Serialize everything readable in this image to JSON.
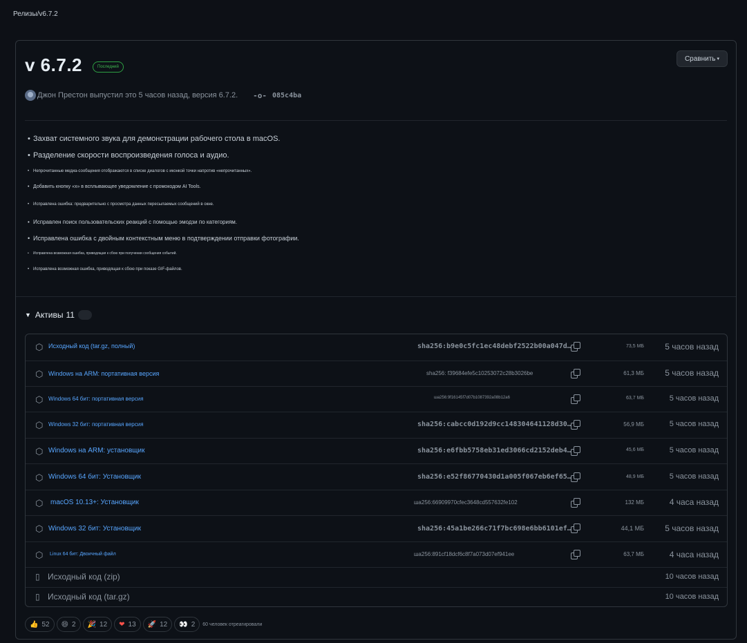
{
  "breadcrumb": "Релизы/v6.7.2",
  "release": {
    "title": "v 6.7.2",
    "badge": "Последний",
    "compare_label": "Сравнить",
    "compare_caret": "▾",
    "byline": "Джон Престон выпустил это 5 часов назад, версия 6.7.2.",
    "commit": "085c4ba"
  },
  "notes": [
    "Захват системного звука для демонстрации рабочего стола в macOS.",
    "Разделение скорости воспроизведения голоса и аудио.",
    "Непрочитанные медиа-сообщения отображаются в списке диалогов с иконкой точки напротив «непрочитанных».",
    "Добавить кнопку «х» в всплывающее уведомление с промокодом AI Tools.",
    "Исправлена ошибка: предварительно с просмотра данных пересылаемых сообщений в окне.",
    "Исправлен поиск пользовательских реакций с помощью эмодзи по категориям.",
    "Исправлена ошибка с двойным контекстным меню в подтверждении отправки фотографии.",
    "Исправлена возможная ошибка, приводящая к сбою при получении сообщения событий.",
    "Исправлена возможная ошибка, приводящая к сбою при показе GIF-файлов."
  ],
  "assets": {
    "label": "Активы",
    "count": "11",
    "items": [
      {
        "icon": "package-icon",
        "name": "Исходный код (tar.gz, полный)",
        "sha": "sha256:b9e0c5fc1ec48debf2522b00a047d…",
        "size": "73,5 МБ",
        "time": "5 часов назад"
      },
      {
        "icon": "package-icon",
        "name": "Windows на ARM: портативная версия",
        "sha": "sha256: f39684efe5c10253072c28b3026be",
        "size": "61,3 МБ",
        "time": "5 часов назад"
      },
      {
        "icon": "package-icon",
        "name": "Windows 64 бит: портативная версия",
        "sha": "ша256:9f16145f7d07b1087392a08b12a6",
        "size": "63,7 МБ",
        "time": "5 часов назад"
      },
      {
        "icon": "package-icon",
        "name": "Windows 32 бит: портативная версия",
        "sha": "sha256:cabcc0d192d9cc148304641128d30…",
        "size": "56,9 МБ",
        "time": "5 часов назад"
      },
      {
        "icon": "package-icon",
        "name": "Windows на ARM: установщик",
        "sha": "sha256:e6fbb5758eb31ed3066cd2152deb4…",
        "size": "45,6 МБ",
        "time": "5 часов назад"
      },
      {
        "icon": "package-icon",
        "name": "Windows 64 бит: Установщик",
        "sha": "sha256:e52f86770430d1a005f067eb6ef65…",
        "size": "48,9 МБ",
        "time": "5 часов назад"
      },
      {
        "icon": "package-icon",
        "name": "macOS 10.13+: Установщик",
        "sha": "ша256:66909970cfec3648cd557632fe102",
        "size": "132 МБ",
        "time": "4 часа назад"
      },
      {
        "icon": "package-icon",
        "name": "Windows 32 бит: Установщик",
        "sha": "sha256:45a1be266c71f7bc698e6bb6101ef…",
        "size": "44,1 МБ",
        "time": "5 часов назад"
      },
      {
        "icon": "package-icon",
        "name": "Linux 64 бит: Двоичный файл",
        "sha": "ша256:891cf18dcf6c8f7a073d07ef941ee",
        "size": "63,7 МБ",
        "time": "4 часа назад"
      },
      {
        "icon": "zip-icon",
        "name": "Исходный код (zip)",
        "sha": "",
        "size": "",
        "time": "10 часов назад"
      },
      {
        "icon": "zip-icon",
        "name": "Исходный код (tar.gz)",
        "sha": "",
        "size": "",
        "time": "10 часов назад"
      }
    ]
  },
  "reactions": {
    "items": [
      {
        "icon": "thumbs-up-icon",
        "glyph": "👍",
        "count": "52"
      },
      {
        "icon": "laugh-icon",
        "glyph": "😄",
        "count": "2"
      },
      {
        "icon": "tada-icon",
        "glyph": "🎉",
        "count": "12"
      },
      {
        "icon": "heart-icon",
        "glyph": "❤",
        "count": "13"
      },
      {
        "icon": "rocket-icon",
        "glyph": "🚀",
        "count": "12"
      },
      {
        "icon": "eyes-icon",
        "glyph": "👀",
        "count": "2"
      }
    ],
    "summary": "60 человек отреагировали"
  },
  "colors": {
    "link": "#58a6ff",
    "badge": "#3fb950",
    "background": "#0d1117"
  }
}
